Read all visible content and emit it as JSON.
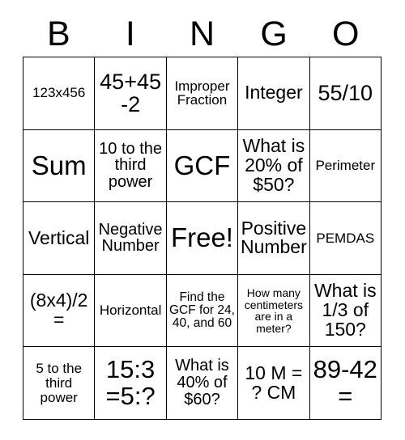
{
  "header": {
    "letters": [
      "B",
      "I",
      "N",
      "G",
      "O"
    ]
  },
  "grid": {
    "rows": [
      [
        {
          "text": "123x456",
          "size": "fs-s"
        },
        {
          "text": "45+45-2",
          "size": "fs-xl"
        },
        {
          "text": "Improper Fraction",
          "size": "fs-s"
        },
        {
          "text": "Integer",
          "size": "fs-l"
        },
        {
          "text": "55/10",
          "size": "fs-xl"
        }
      ],
      [
        {
          "text": "Sum",
          "size": "fs-hg"
        },
        {
          "text": "10 to the third power",
          "size": "fs-m"
        },
        {
          "text": "GCF",
          "size": "fs-hg"
        },
        {
          "text": "What is 20% of $50?",
          "size": "fs-l"
        },
        {
          "text": "Perimeter",
          "size": "fs-s"
        }
      ],
      [
        {
          "text": "Vertical",
          "size": "fs-l"
        },
        {
          "text": "Negative Number",
          "size": "fs-m"
        },
        {
          "text": "Free!",
          "size": "fs-hg"
        },
        {
          "text": "Positive Number",
          "size": "fs-l"
        },
        {
          "text": "PEMDAS",
          "size": "fs-s"
        }
      ],
      [
        {
          "text": "(8x4)/2 =",
          "size": "fs-l"
        },
        {
          "text": "Horizontal",
          "size": "fs-s"
        },
        {
          "text": "Find the GCF for 24, 40, and 60",
          "size": "fs-xs"
        },
        {
          "text": "How many centimeters are in a meter?",
          "size": "fs-xxs"
        },
        {
          "text": "What is 1/3 of 150?",
          "size": "fs-l"
        }
      ],
      [
        {
          "text": "5 to the third power",
          "size": "fs-s"
        },
        {
          "text": "15:3 =5:?",
          "size": "fs-xxl"
        },
        {
          "text": "What is 40% of $60?",
          "size": "fs-m"
        },
        {
          "text": "10 M = ? CM",
          "size": "fs-l"
        },
        {
          "text": "89-42 =",
          "size": "fs-xxl"
        }
      ]
    ]
  },
  "colors": {
    "border": "#000000",
    "text": "#000000",
    "background": "#ffffff"
  }
}
